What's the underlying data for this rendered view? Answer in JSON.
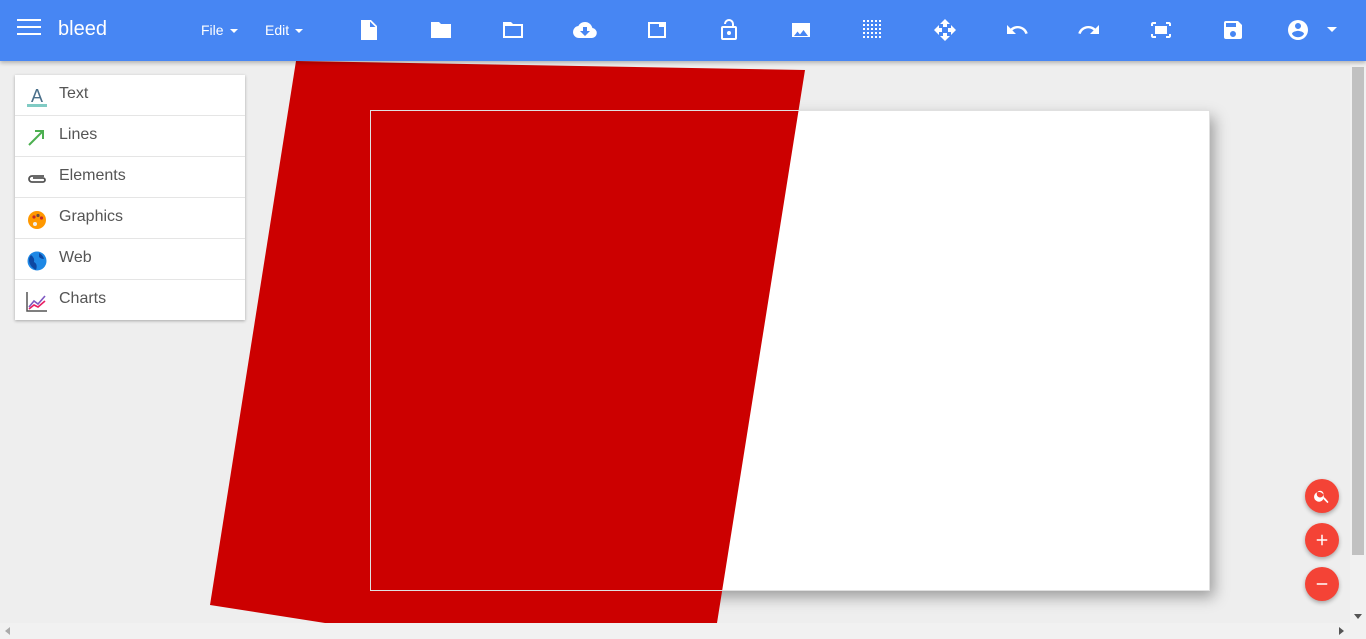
{
  "app": {
    "title": "bleed"
  },
  "menus": {
    "file": "File",
    "edit": "Edit"
  },
  "toolbar_icons": [
    "new-document",
    "open-folder",
    "folder-outline",
    "cloud-download",
    "window",
    "lock-open",
    "image",
    "grid-dots",
    "move-arrows",
    "undo",
    "redo",
    "fit-screen",
    "save",
    "account-circle"
  ],
  "panel": {
    "items": [
      {
        "label": "Text",
        "icon": "text-icon"
      },
      {
        "label": "Lines",
        "icon": "arrow-line-icon"
      },
      {
        "label": "Elements",
        "icon": "paperclip-icon"
      },
      {
        "label": "Graphics",
        "icon": "palette-icon"
      },
      {
        "label": "Web",
        "icon": "globe-icon"
      },
      {
        "label": "Charts",
        "icon": "line-chart-icon"
      }
    ]
  },
  "canvas": {
    "shape_color": "#cc0000",
    "page_color": "#ffffff"
  },
  "fabs": [
    "zoom-search",
    "zoom-in",
    "zoom-out"
  ],
  "colors": {
    "topbar": "#4786f3",
    "fab": "#f44336",
    "background": "#eeeeee"
  }
}
